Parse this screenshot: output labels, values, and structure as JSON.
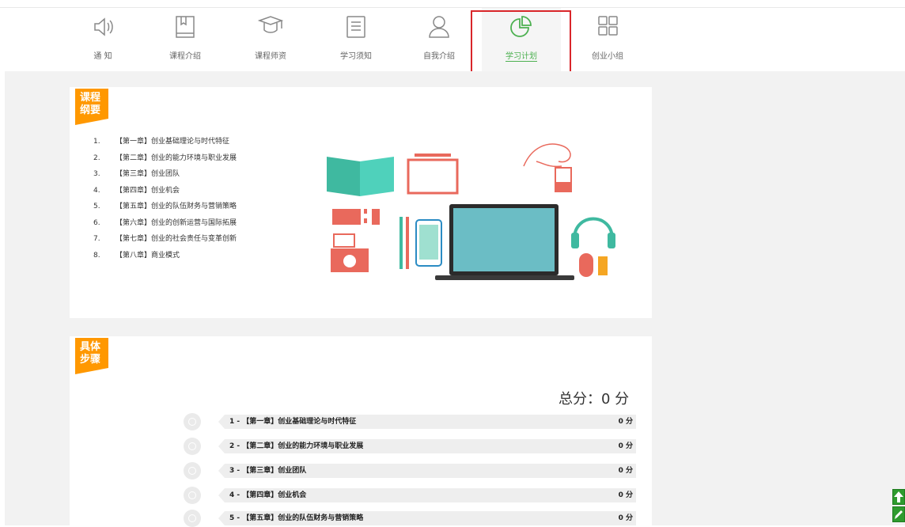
{
  "nav": {
    "items": [
      {
        "label": "通 知",
        "icon": "speaker-icon"
      },
      {
        "label": "课程介绍",
        "icon": "book-icon"
      },
      {
        "label": "课程师资",
        "icon": "graduation-cap-icon"
      },
      {
        "label": "学习须知",
        "icon": "notes-icon"
      },
      {
        "label": "自我介绍",
        "icon": "user-icon"
      },
      {
        "label": "学习计划",
        "icon": "pie-chart-icon",
        "active": true
      },
      {
        "label": "创业小组",
        "icon": "grid-icon"
      }
    ],
    "accent_color": "#4cb050",
    "highlight_color": "#d9262a"
  },
  "outline": {
    "tag": "课程纲要",
    "items": [
      {
        "num": "1.",
        "text": "【第一章】创业基础理论与时代特征"
      },
      {
        "num": "2.",
        "text": "【第二章】创业的能力环境与职业发展"
      },
      {
        "num": "3.",
        "text": "【第三章】创业团队"
      },
      {
        "num": "4.",
        "text": "【第四章】创业机会"
      },
      {
        "num": "5.",
        "text": "【第五章】创业的队伍财务与营销策略"
      },
      {
        "num": "6.",
        "text": "【第六章】创业的创新运营与国际拓展"
      },
      {
        "num": "7.",
        "text": "【第七章】创业的社会责任与变革创新"
      },
      {
        "num": "8.",
        "text": "【第八章】商业模式"
      }
    ]
  },
  "steps": {
    "tag": "具体步骤",
    "total": "总分：0 分",
    "items": [
      {
        "title": "1 - 【第一章】创业基础理论与时代特征",
        "score": "0 分"
      },
      {
        "title": "2 - 【第二章】创业的能力环境与职业发展",
        "score": "0 分"
      },
      {
        "title": "3 - 【第三章】创业团队",
        "score": "0 分"
      },
      {
        "title": "4 - 【第四章】创业机会",
        "score": "0 分"
      },
      {
        "title": "5 - 【第五章】创业的队伍财务与营销策略",
        "score": "0 分"
      }
    ]
  },
  "tag_color": "#ff9800",
  "side_buttons": [
    {
      "icon": "arrow-up-icon"
    },
    {
      "icon": "pencil-icon"
    }
  ]
}
